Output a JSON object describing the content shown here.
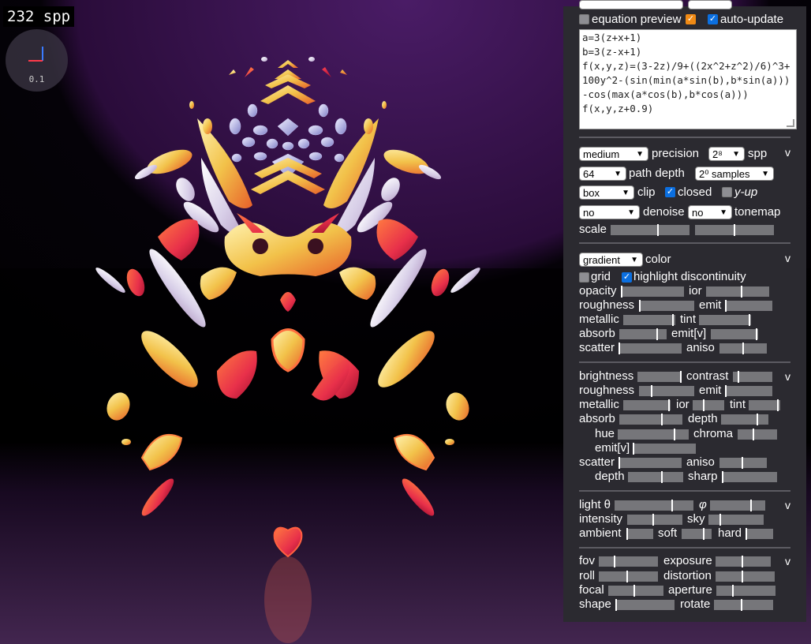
{
  "viewport": {
    "spp_text": "232 spp",
    "axis_scale": "0.1"
  },
  "equation": {
    "preview_label": "equation preview",
    "preview_checked": false,
    "autoupdate_label": "auto-update",
    "autoupdate_checked": true,
    "text": "a=3(z+x+1)\nb=3(z-x+1)\nf(x,y,z)=(3-2z)/9+((2x^2+z^2)/6)^3+100y^2-(sin(min(a*sin(b),b*sin(a)))-cos(max(a*cos(b),b*cos(a)))\nf(x,y,z+0.9)"
  },
  "render": {
    "precision_value": "medium",
    "precision_label": "precision",
    "spp_value": "2⁸",
    "spp_label": "spp",
    "pathdepth_value": "64",
    "pathdepth_label": "path depth",
    "samples_value": "2⁰ samples",
    "clip_value": "box",
    "clip_label": "clip",
    "closed_label": "closed",
    "closed_checked": true,
    "yup_label": "y-up",
    "yup_checked": false,
    "denoise_value": "no",
    "denoise_label": "denoise",
    "tonemap_value": "no",
    "tonemap_label": "tonemap",
    "scale_label": "scale",
    "toggle": "v"
  },
  "material": {
    "color_value": "gradient",
    "color_label": "color",
    "grid_label": "grid",
    "grid_checked": false,
    "highlight_label": "highlight discontinuity",
    "highlight_checked": true,
    "toggle": "v",
    "opacity": "opacity",
    "ior": "ior",
    "roughness": "roughness",
    "emit": "emit",
    "metallic": "metallic",
    "tint": "tint",
    "absorb": "absorb",
    "emitv": "emit[v]",
    "scatter": "scatter",
    "aniso": "aniso"
  },
  "grading": {
    "toggle": "v",
    "brightness": "brightness",
    "contrast": "contrast",
    "roughness": "roughness",
    "emit": "emit",
    "metallic": "metallic",
    "ior": "ior",
    "tint": "tint",
    "absorb": "absorb",
    "depth": "depth",
    "hue": "hue",
    "chroma": "chroma",
    "emitv": "emit[v]",
    "scatter": "scatter",
    "aniso": "aniso",
    "depth2": "depth",
    "sharp": "sharp"
  },
  "lighting": {
    "toggle": "v",
    "light_theta": "light θ",
    "phi": "φ",
    "intensity": "intensity",
    "sky": "sky",
    "ambient": "ambient",
    "soft": "soft",
    "hard": "hard"
  },
  "camera": {
    "toggle": "v",
    "fov": "fov",
    "exposure": "exposure",
    "roll": "roll",
    "distortion": "distortion",
    "focal": "focal",
    "aperture": "aperture",
    "shape": "shape",
    "rotate": "rotate"
  },
  "colors": {
    "panel_bg": "#2b2a30",
    "checkbox_on": "#0b6fe0",
    "checkbox_preview": "#f08a15",
    "slider_track": "#76767a"
  }
}
